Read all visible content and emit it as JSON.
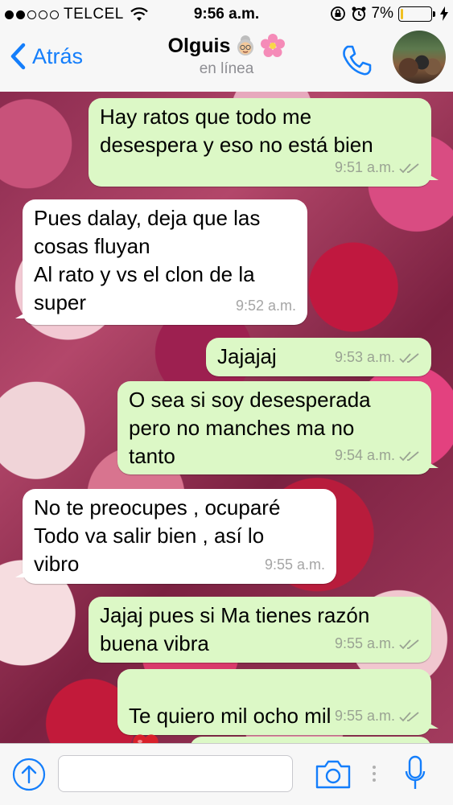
{
  "status_bar": {
    "carrier": "TELCEL",
    "time": "9:56 a.m.",
    "battery": "7%",
    "battery_level": 0.07,
    "signal_bars": 2,
    "signal_total": 5
  },
  "nav": {
    "back_label": "Atrás",
    "contact_name": "Olguis",
    "contact_status": "en línea"
  },
  "messages": [
    {
      "side": "out",
      "text": "Hay ratos que todo me\ndesespera y eso no está bien",
      "time": "9:51 a.m."
    },
    {
      "side": "in",
      "text": "Pues dalay, deja que las\ncosas fluyan\nAl rato y vs el clon de la\nsuper",
      "time": "9:52 a.m."
    },
    {
      "side": "out",
      "text": "Jajajaj",
      "time": "9:53 a.m."
    },
    {
      "side": "out",
      "text": "O sea si soy desesperada\npero no manches ma no\ntanto",
      "time": "9:54 a.m."
    },
    {
      "side": "in",
      "text": "No te preocupes , ocuparé\nTodo va salir bien , así lo\nvibro",
      "time": "9:55 a.m."
    },
    {
      "side": "out",
      "text": "Jajaj pues si Ma tienes razón\nbuena vibra",
      "time": "9:55 a.m."
    },
    {
      "side": "out",
      "text": "Te quiero mil ocho mil",
      "time": "9:55 a.m."
    }
  ],
  "input": {
    "placeholder": ""
  },
  "colors": {
    "accent": "#147efb",
    "outgoing_bubble": "#dcf8c6",
    "incoming_bubble": "#ffffff",
    "read_ticks": "#9aa393"
  },
  "icons": [
    "back-chevron-icon",
    "phone-icon",
    "avatar",
    "upload-icon",
    "camera-icon",
    "microphone-icon",
    "heart-emoji-icon",
    "grandmother-emoji-icon",
    "flower-emoji-icon"
  ]
}
